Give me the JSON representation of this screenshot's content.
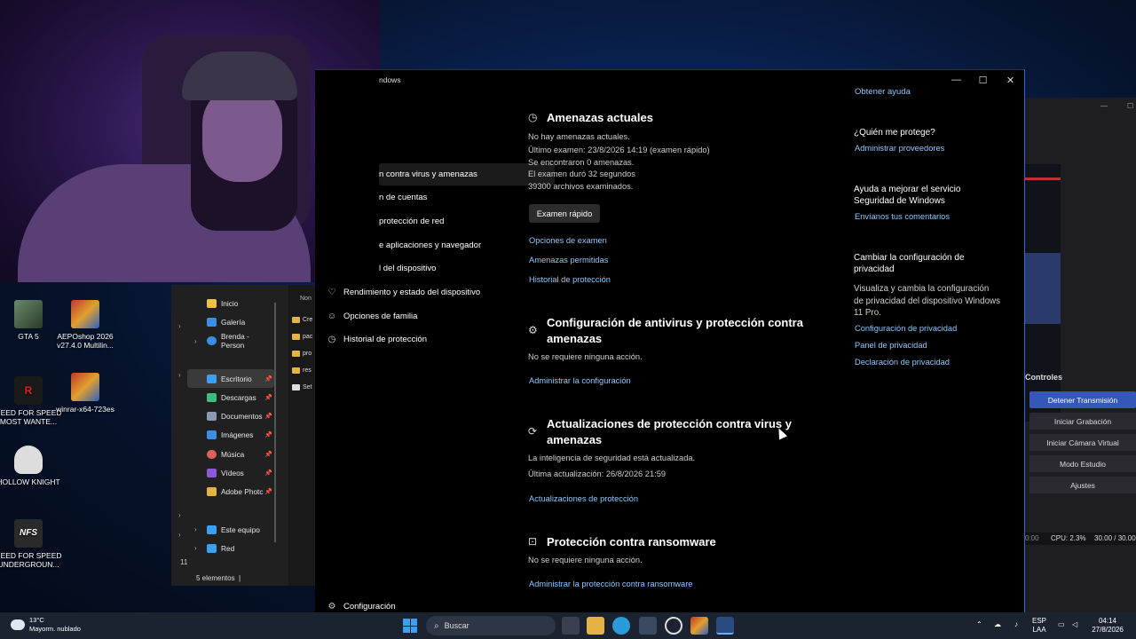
{
  "webcam": {},
  "desktop": {
    "icons": [
      {
        "label": "GTA 5",
        "icon": "gta5-icon"
      },
      {
        "label": "AEPOshop 2026 v27.4.0 Multilin...",
        "icon": "winrar-icon"
      },
      {
        "label": "NEED FOR SPEED MOST WANTE...",
        "icon": "nfs-mw-icon"
      },
      {
        "label": "winrar-x64-723es",
        "icon": "winrar-icon"
      },
      {
        "label": "HOLLOW KNIGHT",
        "icon": "hollow-knight-icon"
      },
      {
        "label": "NEED FOR SPEED UNDERGROUN...",
        "icon": "nfs-underground-icon"
      }
    ]
  },
  "explorer": {
    "nav": [
      {
        "label": "Inicio",
        "icon": "home-icon",
        "color": "#f0c040"
      },
      {
        "label": "Galería",
        "icon": "gallery-icon",
        "color": "#3a8ee6"
      },
      {
        "label": "Brenda - Person",
        "icon": "onedrive-icon",
        "color": "#3a8ee6"
      },
      {
        "label": "Escritorio",
        "icon": "desktop-icon",
        "color": "#3aa0f0"
      },
      {
        "label": "Descargas",
        "icon": "downloads-icon",
        "color": "#3ac07a"
      },
      {
        "label": "Documentos",
        "icon": "documents-icon",
        "color": "#8a9ab0"
      },
      {
        "label": "Imágenes",
        "icon": "images-icon",
        "color": "#3a8ee6"
      },
      {
        "label": "Música",
        "icon": "music-icon",
        "color": "#e0605a"
      },
      {
        "label": "Vídeos",
        "icon": "videos-icon",
        "color": "#8a5ad6"
      },
      {
        "label": "Adobe Photc",
        "icon": "folder-icon",
        "color": "#e4b343"
      },
      {
        "label": "Este equipo",
        "icon": "computer-icon",
        "color": "#3aa0f0"
      },
      {
        "label": "Red",
        "icon": "network-icon",
        "color": "#3aa0f0"
      }
    ],
    "file_header": "Non",
    "files": [
      "Cre",
      "pac",
      "pro",
      "res",
      "Set"
    ],
    "status": "5 elementos",
    "left_number": "11"
  },
  "defender": {
    "title": "ndows",
    "get_help": "Obtener ayuda",
    "sidebar": [
      {
        "label": "n contra virus y amenazas",
        "icon": ""
      },
      {
        "label": "n de cuentas",
        "icon": ""
      },
      {
        "label": "protección de red",
        "icon": ""
      },
      {
        "label": "e aplicaciones y navegador",
        "icon": ""
      },
      {
        "label": "l del dispositivo",
        "icon": ""
      },
      {
        "label": "Rendimiento y estado del dispositivo",
        "icon": "heart-icon"
      },
      {
        "label": "Opciones de familia",
        "icon": "family-icon"
      },
      {
        "label": "Historial de protección",
        "icon": "history-icon"
      }
    ],
    "settings_label": "Configuración",
    "threats": {
      "heading": "Amenazas actuales",
      "lines": [
        "No hay amenazas actuales.",
        "Último examen: 23/8/2026 14:19 (examen rápido)",
        "Se encontraron 0 amenazas.",
        "El examen duró 32 segundos",
        "39300 archivos examinados."
      ],
      "quick_scan": "Examen rápido",
      "links": [
        "Opciones de examen",
        "Amenazas permitidas",
        "Historial de protección"
      ]
    },
    "settings_section": {
      "heading": "Configuración de antivirus y protección contra amenazas",
      "text": "No se requiere ninguna acción.",
      "link": "Administrar la configuración"
    },
    "updates": {
      "heading": "Actualizaciones de protección contra virus y amenazas",
      "text": "La inteligencia de seguridad está actualizada.",
      "last_update": "Última actualización: 26/8/2026 21:59",
      "link": "Actualizaciones de protección"
    },
    "ransomware": {
      "heading": "Protección contra ransomware",
      "text": "No se requiere ninguna acción.",
      "link": "Administrar la protección contra ransomware"
    },
    "right": {
      "who_title": "¿Quién me protege?",
      "who_link": "Administrar proveedores",
      "help_title": "Ayuda a mejorar el servicio Seguridad de Windows",
      "help_link": "Envíanos tus comentarios",
      "privacy_title": "Cambiar la configuración de privacidad",
      "privacy_text": "Visualiza y cambia la configuración de privacidad del dispositivo Windows 11 Pro.",
      "privacy_links": [
        "Configuración de privacidad",
        "Panel de privacidad",
        "Declaración de privacidad"
      ]
    }
  },
  "obs": {
    "controls_title": "Controles",
    "buttons": [
      "Detener Transmisión",
      "Iniciar Grabación",
      "Iniciar Cámara Virtual",
      "Modo Estudio",
      "Ajustes"
    ],
    "stats_time": "0:00",
    "stats_cpu": "CPU: 2.3%",
    "stats_fps": "30.00 / 30.00"
  },
  "taskbar": {
    "temp": "13°C",
    "weather": "Mayorm. nublado",
    "search_placeholder": "Buscar",
    "lang_top": "ESP",
    "lang_bottom": "LAA",
    "time": "04:14",
    "date": "27/8/2026"
  }
}
